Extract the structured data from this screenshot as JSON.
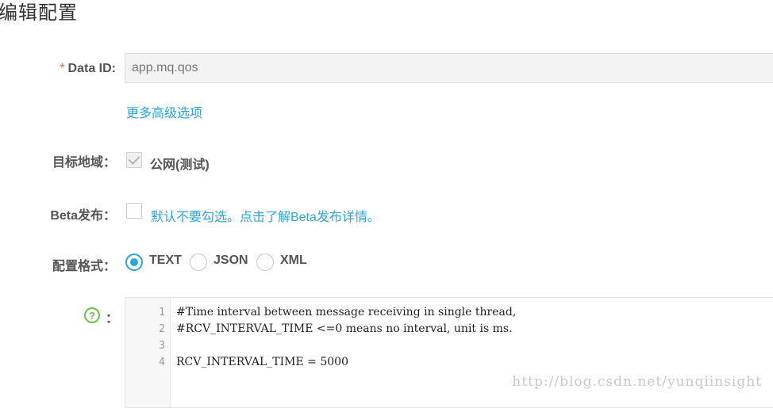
{
  "page": {
    "title": "编辑配置"
  },
  "form": {
    "data_id": {
      "required_mark": "*",
      "label": "Data ID:",
      "value": "app.mq.qos"
    },
    "advanced_link": "更多高级选项",
    "region": {
      "label": "目标地域：",
      "option": "公网(测试)",
      "checked": true
    },
    "beta": {
      "label": "Beta发布：",
      "hint": "默认不要勾选。点击了解Beta发布详情。",
      "checked": false
    },
    "format": {
      "label": "配置格式：",
      "options": [
        "TEXT",
        "JSON",
        "XML"
      ],
      "selected": "TEXT"
    },
    "content": {
      "help_icon": "question-circle-icon",
      "help_glyph": "?",
      "colon": "：",
      "line_numbers": [
        "1",
        "2",
        "3",
        "4"
      ],
      "lines": [
        "#Time interval between message receiving in single thread,",
        "#RCV_INTERVAL_TIME <=0 means no interval, unit is ms.",
        "",
        "RCV_INTERVAL_TIME = 5000"
      ]
    }
  },
  "watermark": "http://blog.csdn.net/yunqiinsight",
  "colors": {
    "accent": "#2aa7d8",
    "help": "#6cbf47",
    "required": "#e06b3c"
  }
}
